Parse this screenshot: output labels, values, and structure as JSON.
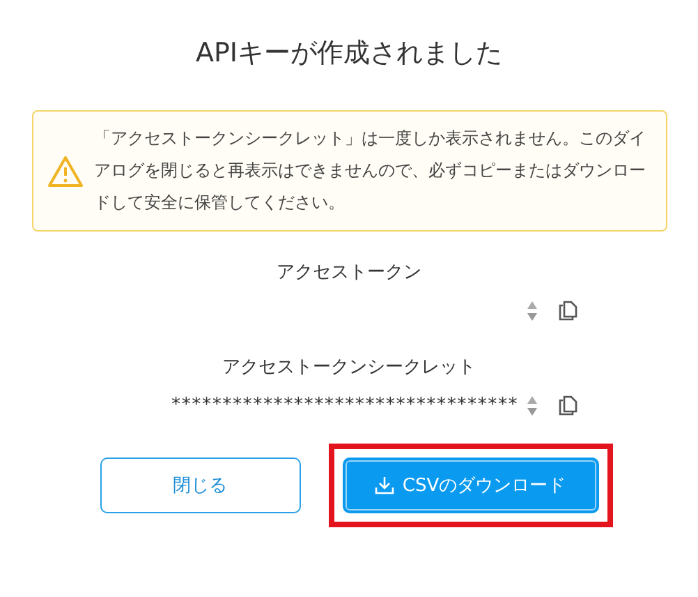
{
  "dialog": {
    "title": "APIキーが作成されました"
  },
  "warning": {
    "text": "「アクセストークンシークレット」は一度しか表示されません。このダイアログを閉じると再表示はできませんので、必ずコピーまたはダウンロードして安全に保管してください。"
  },
  "fields": [
    {
      "label": "アクセストークン"
    },
    {
      "label": "アクセストークンシークレット",
      "value": "**********************************"
    }
  ],
  "buttons": [
    {
      "label": "閉じる",
      "kind": "secondary",
      "highlighted": false
    },
    {
      "label": "CSVのダウンロード",
      "kind": "primary",
      "highlighted": true
    }
  ]
}
